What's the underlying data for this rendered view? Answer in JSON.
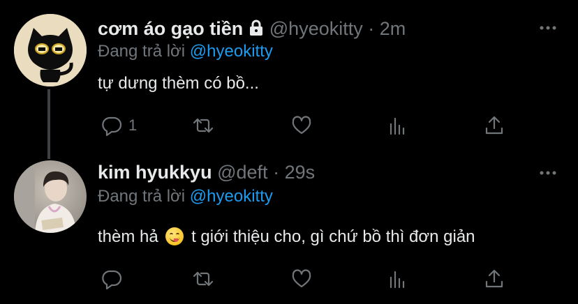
{
  "tweets": [
    {
      "display_name": "cơm áo gạo tiền",
      "handle": "@hyeokitty",
      "separator": "·",
      "time": "2m",
      "replying_prefix": "Đang trả lời",
      "replying_to": "@hyeokitty",
      "text": "tự dưng thèm có bồ...",
      "reply_count": "1",
      "protected": true,
      "avatar_icon": "black-cat-avatar"
    },
    {
      "display_name": "kim hyukkyu",
      "handle": "@deft",
      "separator": "·",
      "time": "29s",
      "replying_prefix": "Đang trả lời",
      "replying_to": "@hyeokitty",
      "text_before": "thèm hả",
      "text_after": "t giới thiệu cho, gì chứ bồ thì đơn giản",
      "emoji": "savoring-food-emoji",
      "reply_count": "",
      "avatar_icon": "person-photo-avatar"
    }
  ],
  "colors": {
    "background": "#000000",
    "text": "#e7e9ea",
    "muted": "#71767b",
    "link": "#1d9bf0",
    "thread_line": "#3e4144"
  },
  "icons": [
    "reply-icon",
    "retweet-icon",
    "like-icon",
    "analytics-icon",
    "share-icon",
    "more-icon",
    "lock-icon"
  ]
}
